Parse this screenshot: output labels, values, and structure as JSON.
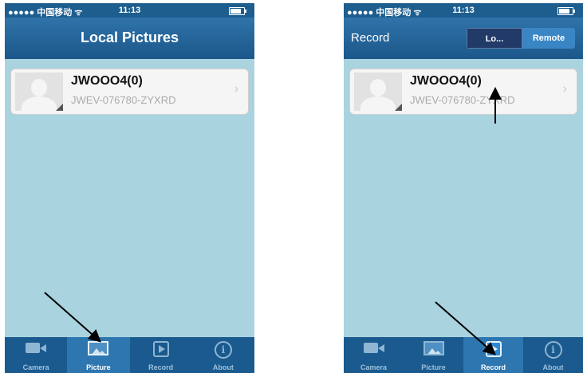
{
  "left_screen": {
    "status": {
      "carrier": "●●●●● 中国移动 ᯤ",
      "time": "11:13",
      "battery_level": 0.7
    },
    "nav": {
      "title": "Local Pictures"
    },
    "device": {
      "name": "JWOOO4(0)",
      "id": "JWEV-076780-ZYXRD",
      "chevron": "›"
    },
    "tabs": [
      {
        "label": "Camera",
        "icon": "camera-icon",
        "active": false
      },
      {
        "label": "Picture",
        "icon": "picture-icon",
        "active": true
      },
      {
        "label": "Record",
        "icon": "record-icon",
        "active": false
      },
      {
        "label": "About",
        "icon": "info-icon",
        "active": false
      }
    ]
  },
  "right_screen": {
    "status": {
      "carrier": "●●●●● 中国移动 ᯤ",
      "time": "11:13",
      "battery_level": 0.7
    },
    "nav": {
      "title": "Record",
      "segments": [
        "Lo...",
        "Remote"
      ],
      "selected_segment": "Lo..."
    },
    "device": {
      "name": "JWOOO4(0)",
      "id": "JWEV-076780-ZYXRD",
      "chevron": "›"
    },
    "tabs": [
      {
        "label": "Camera",
        "icon": "camera-icon",
        "active": false
      },
      {
        "label": "Picture",
        "icon": "picture-icon",
        "active": false
      },
      {
        "label": "Record",
        "icon": "record-icon",
        "active": true
      },
      {
        "label": "About",
        "icon": "info-icon",
        "active": false
      }
    ]
  },
  "about_glyph": "i",
  "colors": {
    "background": "#a9d3df",
    "navbar": "#1c578a",
    "tabbar": "#1a5a8e",
    "annotation_arrow": "#000000"
  }
}
